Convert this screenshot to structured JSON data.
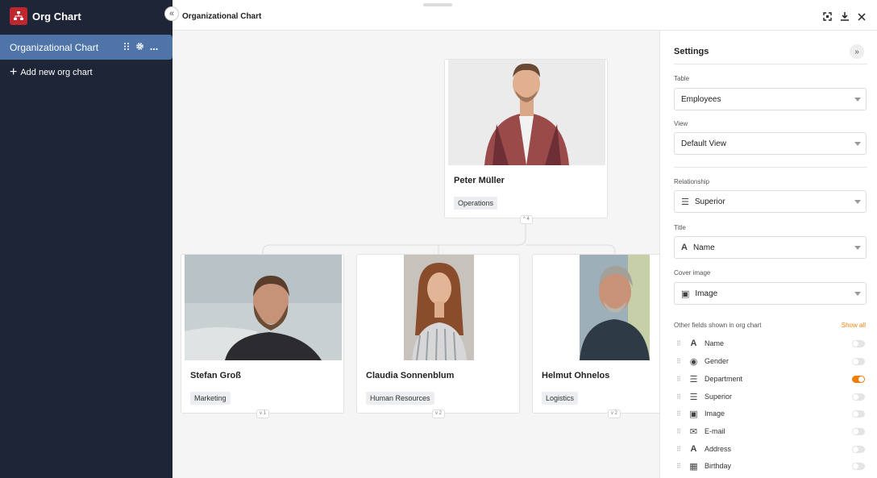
{
  "app": {
    "title": "Org Chart"
  },
  "sidebar": {
    "items": [
      {
        "label": "Organizational Chart"
      }
    ],
    "add_label": "Add new org chart"
  },
  "main": {
    "title": "Organizational Chart"
  },
  "chart": {
    "root": {
      "name": "Peter Müller",
      "tag": "Operations",
      "children_count": "4"
    },
    "children": [
      {
        "name": "Stefan Groß",
        "tag": "Marketing",
        "children_count": "1"
      },
      {
        "name": "Claudia Sonnenblum",
        "tag": "Human Resources",
        "children_count": "2"
      },
      {
        "name": "Helmut Ohnelos",
        "tag": "Logistics",
        "children_count": "2"
      }
    ]
  },
  "settings": {
    "title": "Settings",
    "table": {
      "label": "Table",
      "value": "Employees"
    },
    "view": {
      "label": "View",
      "value": "Default View"
    },
    "relationship": {
      "label": "Relationship",
      "value": "Superior"
    },
    "title_field": {
      "label": "Title",
      "value": "Name"
    },
    "cover_image": {
      "label": "Cover image",
      "value": "Image"
    },
    "other_fields_label": "Other fields shown in org chart",
    "show_all": "Show all",
    "fields": [
      {
        "label": "Name",
        "icon": "text-icon",
        "enabled": false
      },
      {
        "label": "Gender",
        "icon": "single-select-icon",
        "enabled": false
      },
      {
        "label": "Department",
        "icon": "link-icon",
        "enabled": true
      },
      {
        "label": "Superior",
        "icon": "link-icon",
        "enabled": false
      },
      {
        "label": "Image",
        "icon": "image-icon",
        "enabled": false
      },
      {
        "label": "E-mail",
        "icon": "email-icon",
        "enabled": false
      },
      {
        "label": "Address",
        "icon": "text-icon",
        "enabled": false
      },
      {
        "label": "Birthday",
        "icon": "calendar-icon",
        "enabled": false
      }
    ]
  },
  "colors": {
    "sidebar_bg": "#1d2537",
    "active_item": "#4e74a8",
    "accent": "#f07c0a",
    "logo": "#c0262d"
  }
}
